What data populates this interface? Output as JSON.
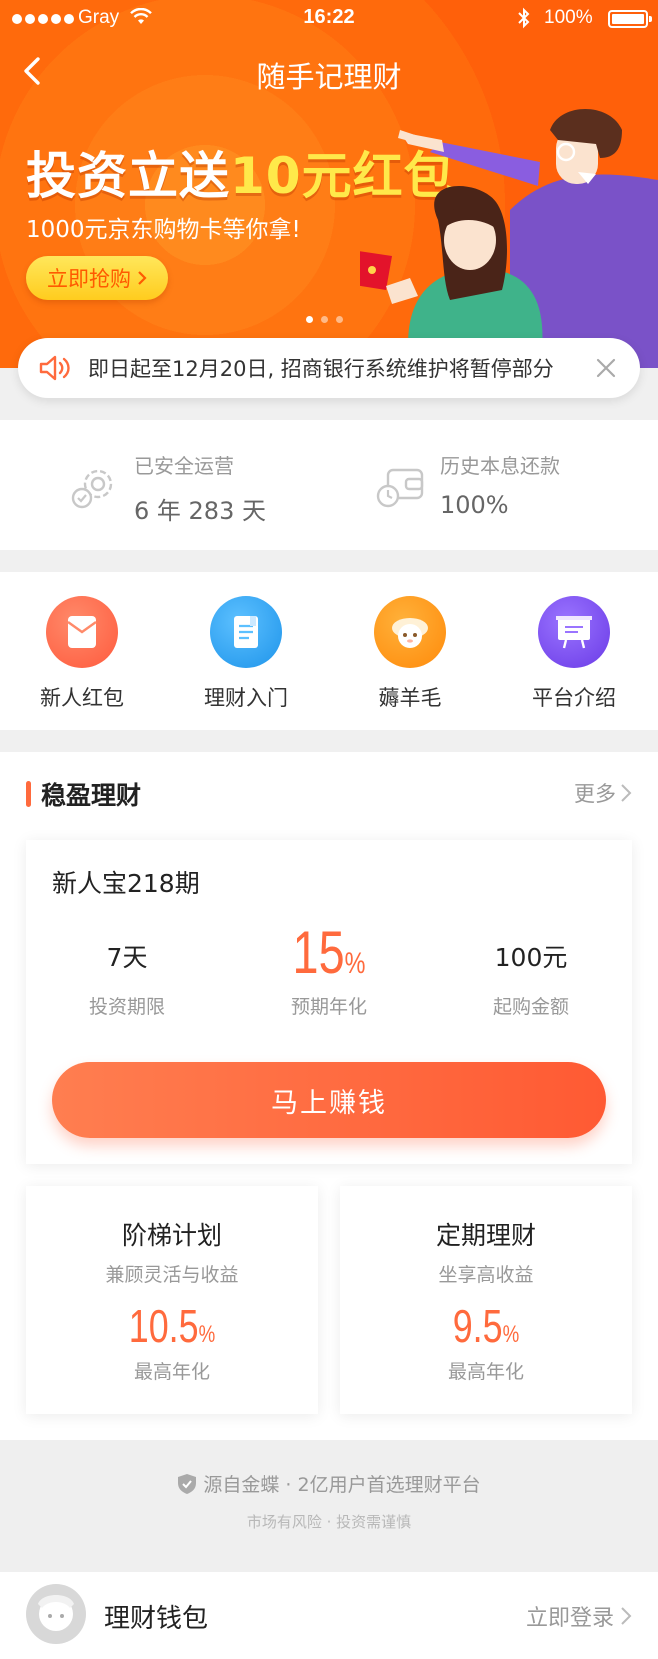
{
  "status_bar": {
    "carrier": "Gray",
    "time": "16:22",
    "battery": "100%"
  },
  "nav": {
    "title": "随手记理财"
  },
  "banner": {
    "headline_pre": "投资立送",
    "headline_highlight": "10元红包",
    "subtitle": "1000元京东购物卡等你拿!",
    "button_label": "立即抢购",
    "slides": 3,
    "active_slide": 1
  },
  "notice": {
    "text": "即日起至12月20日, 招商银行系统维护将暂停部分"
  },
  "stats": [
    {
      "label": "已安全运营",
      "value": "6 年 283 天",
      "icon": "gear-shield-icon"
    },
    {
      "label": "历史本息还款",
      "value": "100%",
      "icon": "wallet-clock-icon"
    }
  ],
  "quick_entries": [
    {
      "label": "新人红包",
      "icon": "red-envelope-icon",
      "color": "#ff6a4d"
    },
    {
      "label": "理财入门",
      "icon": "document-icon",
      "color": "#2ea6f2"
    },
    {
      "label": "薅羊毛",
      "icon": "sheep-icon",
      "color": "#ff9a1a"
    },
    {
      "label": "平台介绍",
      "icon": "presentation-board-icon",
      "color": "#7d4ff2"
    }
  ],
  "wenying": {
    "title": "稳盈理财",
    "more_label": "更多",
    "featured": {
      "name": "新人宝218期",
      "term_value": "7天",
      "term_label": "投资期限",
      "rate_value": "15",
      "rate_unit": "%",
      "rate_label": "预期年化",
      "min_value": "100元",
      "min_label": "起购金额",
      "cta_label": "马上赚钱"
    },
    "products": [
      {
        "title": "阶梯计划",
        "subtitle": "兼顾灵活与收益",
        "rate": "10.5",
        "unit": "%",
        "rate_label": "最高年化"
      },
      {
        "title": "定期理财",
        "subtitle": "坐享高收益",
        "rate": "9.5",
        "unit": "%",
        "rate_label": "最高年化"
      }
    ]
  },
  "footer": {
    "origin_line": "源自金蝶 · 2亿用户首选理财平台",
    "risk_line": "市场有风险 · 投资需谨慎"
  },
  "wallet_bar": {
    "title": "理财钱包",
    "login_label": "立即登录"
  },
  "colors": {
    "brand_orange": "#ff6a0c",
    "accent": "#ff6a3d",
    "highlight_yellow": "#ffe94a"
  }
}
